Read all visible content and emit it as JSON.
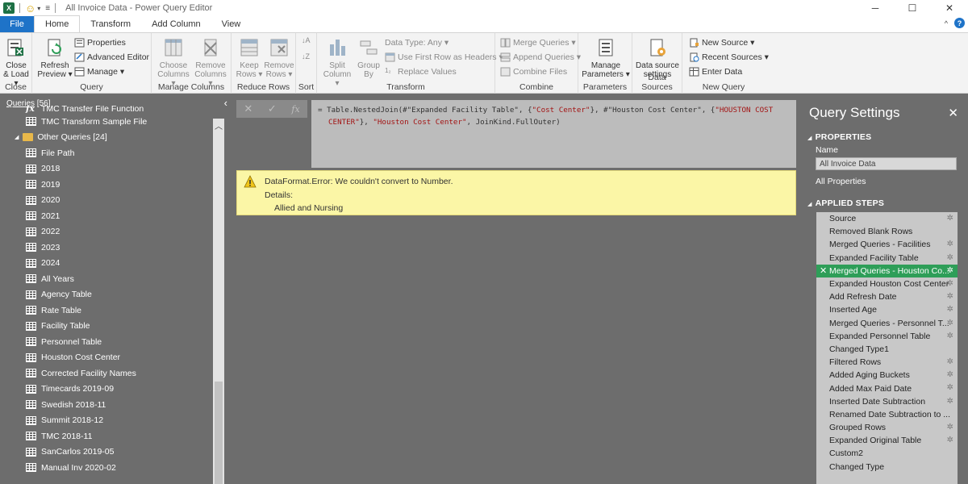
{
  "window": {
    "title": "All Invoice Data - Power Query Editor",
    "app_logo": "X",
    "minimize": "─",
    "maximize": "☐",
    "close": "✕"
  },
  "tabs": [
    "File",
    "Home",
    "Transform",
    "Add Column",
    "View"
  ],
  "help_label": "?",
  "ribbon": {
    "close": {
      "label": "Close",
      "close_load": "Close & Load ▾"
    },
    "query": {
      "label": "Query",
      "refresh": "Refresh Preview ▾",
      "properties": "Properties",
      "advanced_editor": "Advanced Editor",
      "manage": "Manage ▾"
    },
    "manage_columns": {
      "label": "Manage Columns",
      "choose": "Choose Columns ▾",
      "remove": "Remove Columns ▾"
    },
    "reduce_rows": {
      "label": "Reduce Rows",
      "keep": "Keep Rows ▾",
      "remove": "Remove Rows ▾"
    },
    "sort": {
      "label": "Sort"
    },
    "transform": {
      "label": "Transform",
      "split": "Split Column ▾",
      "group": "Group By",
      "data_type": "Data Type: Any ▾",
      "first_row": "Use First Row as Headers ▾",
      "replace": "Replace Values"
    },
    "combine": {
      "label": "Combine",
      "merge": "Merge Queries ▾",
      "append": "Append Queries ▾",
      "combine_files": "Combine Files"
    },
    "parameters": {
      "label": "Parameters",
      "manage": "Manage Parameters ▾"
    },
    "data_sources": {
      "label": "Data Sources",
      "settings": "Data source settings"
    },
    "new_query": {
      "label": "New Query",
      "new_source": "New Source ▾",
      "recent": "Recent Sources ▾",
      "enter": "Enter Data"
    }
  },
  "queries": {
    "header_prefix": "Queries",
    "count": "[56]",
    "items": [
      {
        "type": "fx",
        "label": "TMC Transfer File Function"
      },
      {
        "type": "table",
        "label": "TMC Transform Sample File"
      },
      {
        "type": "folder",
        "label": "Other Queries [24]"
      },
      {
        "type": "table",
        "label": "File Path"
      },
      {
        "type": "table",
        "label": "2018"
      },
      {
        "type": "table",
        "label": "2019"
      },
      {
        "type": "table",
        "label": "2020"
      },
      {
        "type": "table",
        "label": "2021"
      },
      {
        "type": "table",
        "label": "2022"
      },
      {
        "type": "table",
        "label": "2023"
      },
      {
        "type": "table",
        "label": "2024"
      },
      {
        "type": "table",
        "label": "All Years"
      },
      {
        "type": "table",
        "label": "Agency Table"
      },
      {
        "type": "table",
        "label": "Rate Table"
      },
      {
        "type": "table",
        "label": "Facility Table"
      },
      {
        "type": "table",
        "label": "Personnel Table"
      },
      {
        "type": "table",
        "label": "Houston Cost Center"
      },
      {
        "type": "table",
        "label": "Corrected Facility Names"
      },
      {
        "type": "table",
        "label": "Timecards 2019-09"
      },
      {
        "type": "table",
        "label": "Swedish 2018-11"
      },
      {
        "type": "table",
        "label": "Summit 2018-12"
      },
      {
        "type": "table",
        "label": "TMC 2018-11"
      },
      {
        "type": "table",
        "label": "SanCarlos 2019-05"
      },
      {
        "type": "table",
        "label": "Manual Inv 2020-02"
      }
    ]
  },
  "formula": {
    "line1_a": "= Table.NestedJoin(#\"Expanded Facility Table\", {",
    "line1_s1": "\"Cost Center\"",
    "line1_b": "}, #\"Houston Cost Center\", {",
    "line1_s2": "\"HOUSTON COST",
    "line2_s": "CENTER\"",
    "line2_a": "}, ",
    "line2_s2": "\"Houston Cost Center\"",
    "line2_b": ", JoinKind.FullOuter)"
  },
  "error": {
    "title": "DataFormat.Error: We couldn't convert to Number.",
    "details_label": "Details:",
    "value": "Allied and Nursing"
  },
  "settings": {
    "title": "Query Settings",
    "properties": "PROPERTIES",
    "name_label": "Name",
    "name_value": "All Invoice Data",
    "all_properties": "All Properties",
    "applied_steps": "APPLIED STEPS",
    "steps": [
      {
        "label": "Source",
        "gear": true
      },
      {
        "label": "Removed Blank Rows",
        "gear": false
      },
      {
        "label": "Merged Queries - Facilities",
        "gear": true
      },
      {
        "label": "Expanded Facility Table",
        "gear": true
      },
      {
        "label": "Merged Queries - Houston Co...",
        "gear": true,
        "selected": true
      },
      {
        "label": "Expanded Houston Cost Center",
        "gear": true
      },
      {
        "label": "Add Refresh Date",
        "gear": true
      },
      {
        "label": "Inserted Age",
        "gear": true
      },
      {
        "label": "Merged Queries - Personnel T...",
        "gear": true
      },
      {
        "label": "Expanded Personnel Table",
        "gear": true
      },
      {
        "label": "Changed Type1",
        "gear": false
      },
      {
        "label": "Filtered Rows",
        "gear": true
      },
      {
        "label": "Added Aging Buckets",
        "gear": true
      },
      {
        "label": "Added Max Paid Date",
        "gear": true
      },
      {
        "label": "Inserted Date Subtraction",
        "gear": true
      },
      {
        "label": "Renamed Date Subtraction to ...",
        "gear": false
      },
      {
        "label": "Grouped Rows",
        "gear": true
      },
      {
        "label": "Expanded Original Table",
        "gear": true
      },
      {
        "label": "Custom2",
        "gear": false
      },
      {
        "label": "Changed Type",
        "gear": false
      }
    ]
  },
  "colors": {
    "accent": "#1e73c8",
    "selected_step": "#2e9e58",
    "error_bg": "#fbf6a6"
  }
}
